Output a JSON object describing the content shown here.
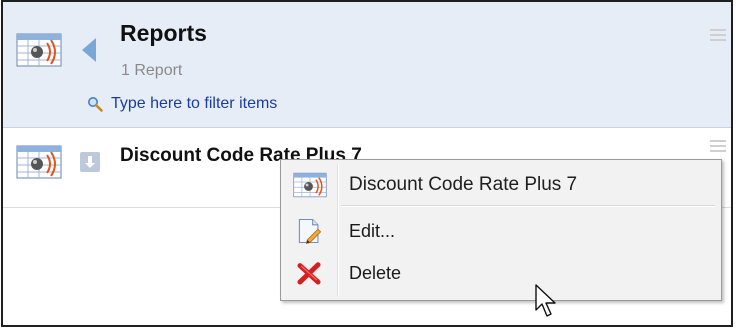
{
  "header": {
    "title": "Reports",
    "subtitle": "1 Report",
    "filter_placeholder": "Type here to filter items"
  },
  "list": {
    "items": [
      {
        "title": "Discount Code Rate Plus 7"
      }
    ]
  },
  "context_menu": {
    "title": "Discount Code Rate Plus 7",
    "items": [
      {
        "label": "Edit...",
        "icon": "edit-document-icon"
      },
      {
        "label": "Delete",
        "icon": "delete-x-icon"
      }
    ]
  },
  "colors": {
    "header_bg": "#e7edf7",
    "link_blue": "#1a3d9c",
    "delete_red": "#d61f1f",
    "arrow_blue": "#7ba7d8"
  }
}
